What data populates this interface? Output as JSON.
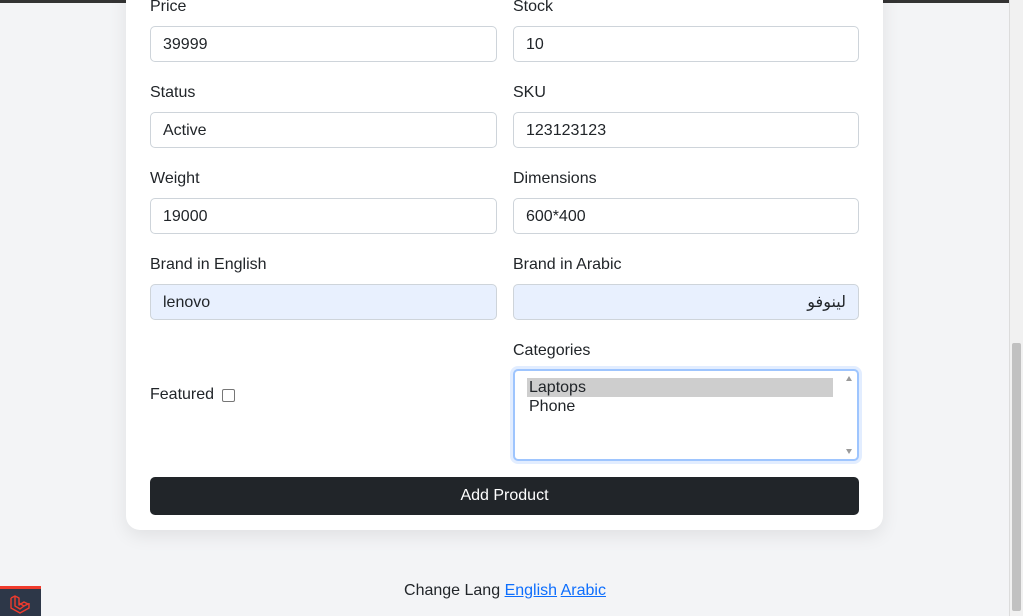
{
  "form": {
    "price": {
      "label": "Price",
      "value": "39999"
    },
    "stock": {
      "label": "Stock",
      "value": "10"
    },
    "status": {
      "label": "Status",
      "value": "Active"
    },
    "sku": {
      "label": "SKU",
      "value": "123123123"
    },
    "weight": {
      "label": "Weight",
      "value": "19000"
    },
    "dimensions": {
      "label": "Dimensions",
      "value": "600*400"
    },
    "brand_en": {
      "label": "Brand in English",
      "value": "lenovo"
    },
    "brand_ar": {
      "label": "Brand in Arabic",
      "value": "لينوفو"
    },
    "featured": {
      "label": "Featured",
      "checked": false
    },
    "categories": {
      "label": "Categories",
      "options": [
        "Laptops",
        "Phone"
      ],
      "selected": "Laptops"
    },
    "submit_label": "Add Product"
  },
  "footer": {
    "text": "Change Lang",
    "links": [
      "English",
      "Arabic"
    ]
  },
  "colors": {
    "button_bg": "#212529",
    "link": "#0d6efd",
    "autofill_bg": "#e8f0fe",
    "laravel_red": "#ef3b2d"
  },
  "icons": {
    "corner_logo": "laravel-logo-icon"
  }
}
